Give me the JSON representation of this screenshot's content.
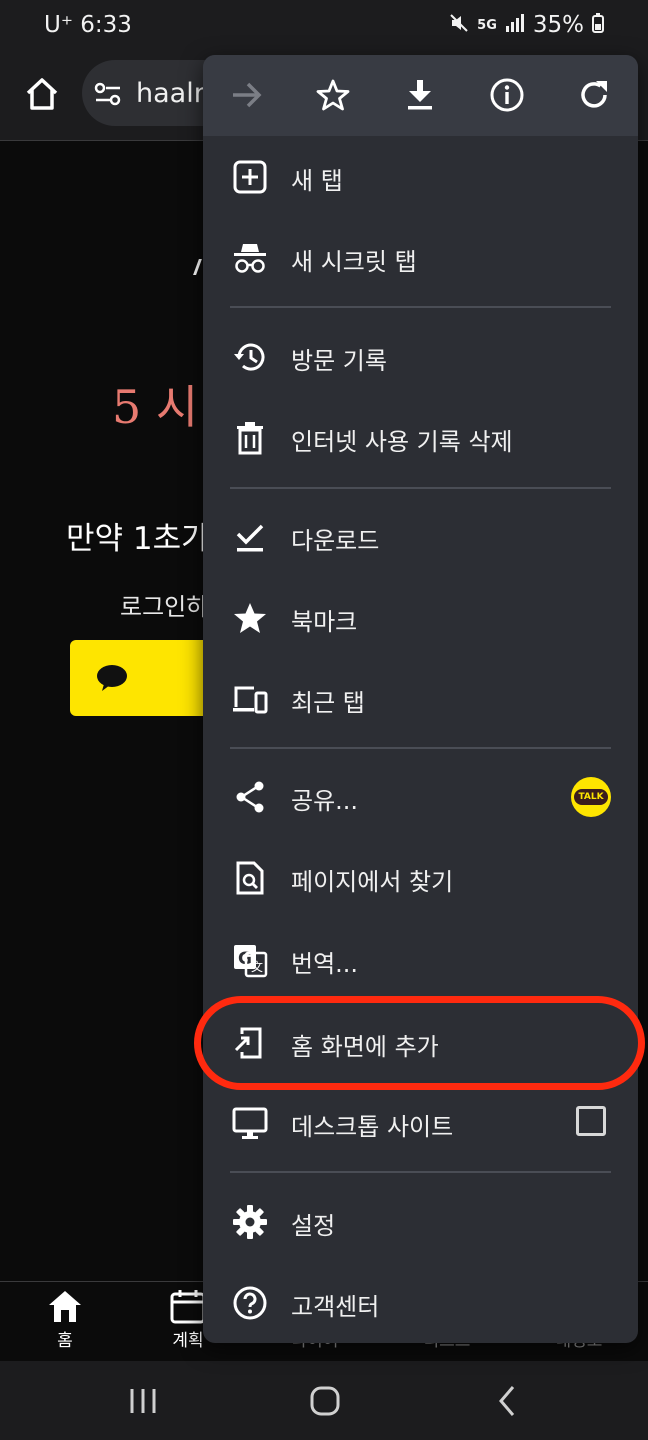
{
  "status_bar": {
    "carrier_time": "U⁺ 6:33",
    "network": "5G",
    "battery": "35%"
  },
  "toolbar": {
    "url": "haaln"
  },
  "page": {
    "headline": "5 시",
    "line": "만약 1초가",
    "login_text": "로그인하"
  },
  "menu": {
    "top_actions": [
      "forward-icon",
      "bookmark-star-icon",
      "download-icon",
      "info-icon",
      "reload-icon"
    ],
    "items": [
      {
        "label": "새 탭"
      },
      {
        "label": "새 시크릿 탭"
      },
      {
        "label": "방문 기록"
      },
      {
        "label": "인터넷 사용 기록 삭제"
      },
      {
        "label": "다운로드"
      },
      {
        "label": "북마크"
      },
      {
        "label": "최근 탭"
      },
      {
        "label": "공유..."
      },
      {
        "label": "페이지에서 찾기"
      },
      {
        "label": "번역..."
      },
      {
        "label": "홈 화면에 추가"
      },
      {
        "label": "데스크톱 사이트"
      },
      {
        "label": "설정"
      },
      {
        "label": "고객센터"
      }
    ],
    "share_badge": "TALK",
    "desktop_site_checked": false,
    "highlighted_item": "홈 화면에 추가",
    "highlight_color": "#ff2a0f"
  },
  "tab_bar": {
    "tabs": [
      {
        "label": "홈"
      },
      {
        "label": "계획"
      },
      {
        "label": "다이어"
      },
      {
        "label": "리스트"
      },
      {
        "label": "내정보"
      }
    ]
  },
  "colors": {
    "menu_bg": "#2c2e34",
    "menu_top_bg": "#383b43",
    "kakao_yellow": "#fee500",
    "headline_pink": "#e77a70"
  }
}
